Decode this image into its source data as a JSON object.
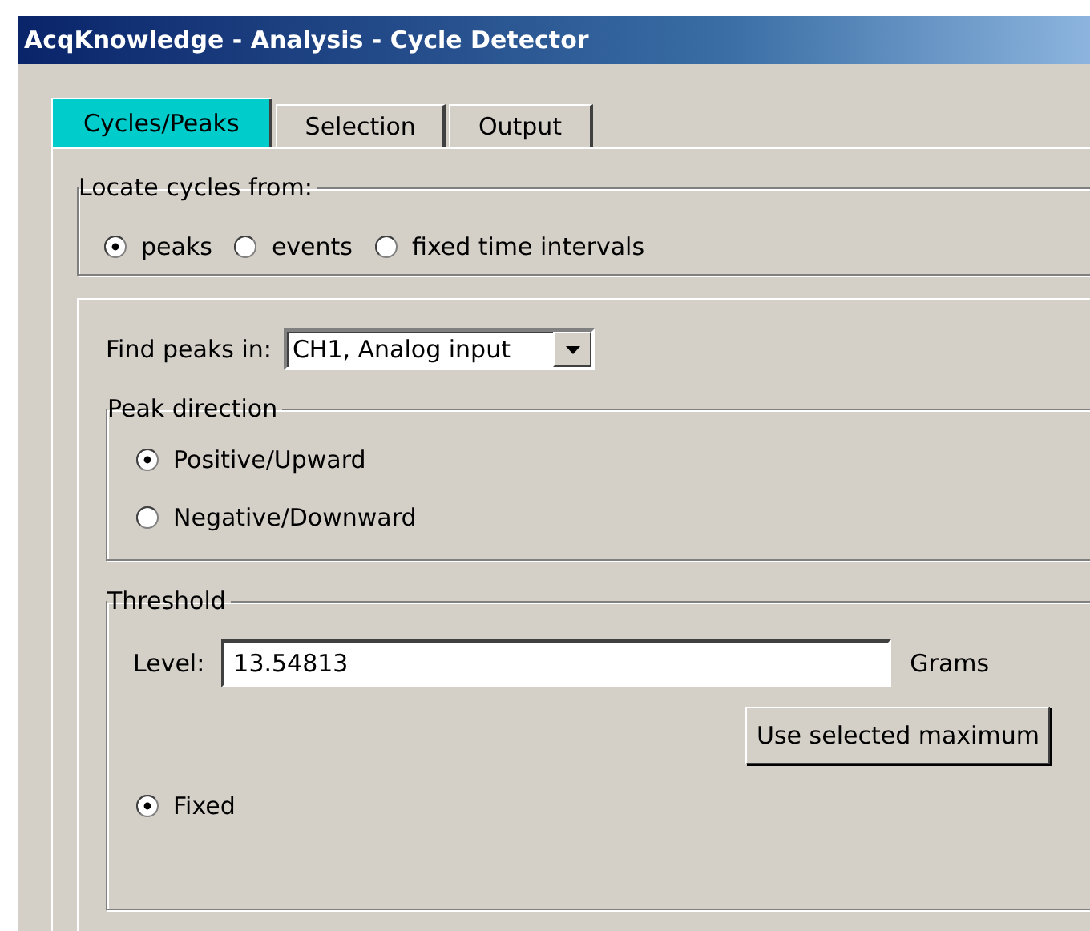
{
  "window": {
    "title": "AcqKnowledge - Analysis - Cycle Detector"
  },
  "tabs": [
    {
      "label": "Cycles/Peaks",
      "selected": true
    },
    {
      "label": "Selection",
      "selected": false
    },
    {
      "label": "Output",
      "selected": false
    }
  ],
  "locate_cycles": {
    "title": "Locate cycles from:",
    "options": [
      {
        "label": "peaks",
        "selected": true
      },
      {
        "label": "events",
        "selected": false
      },
      {
        "label": "fixed time intervals",
        "selected": false
      }
    ]
  },
  "find_peaks": {
    "label": "Find peaks in:",
    "value": "CH1, Analog input"
  },
  "peak_direction": {
    "title": "Peak direction",
    "options": [
      {
        "label": "Positive/Upward",
        "selected": true
      },
      {
        "label": "Negative/Downward",
        "selected": false
      }
    ]
  },
  "threshold": {
    "title": "Threshold",
    "level_label": "Level:",
    "level_value": "13.54813",
    "unit": "Grams",
    "button": "Use selected maximum",
    "options": [
      {
        "label": "Fixed",
        "selected": true
      }
    ]
  }
}
